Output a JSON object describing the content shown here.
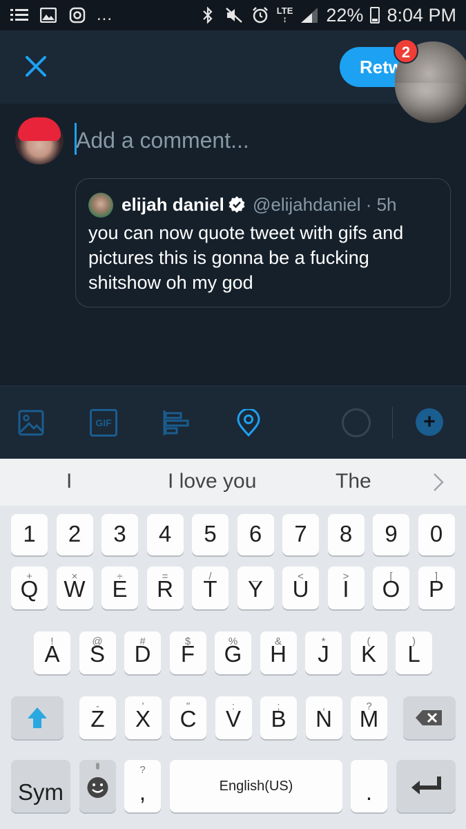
{
  "status_bar": {
    "network": "LTE",
    "battery": "22%",
    "battery_level": 0.22,
    "time": "8:04 PM",
    "overflow": "...",
    "left_icons": [
      "list-icon",
      "gallery-icon",
      "instagram-icon"
    ],
    "right_icons": [
      "bluetooth-icon",
      "mute-icon",
      "alarm-icon",
      "signal-icon",
      "battery-icon"
    ]
  },
  "header": {
    "close_icon": "close-icon",
    "retweet_label": "Retw",
    "notification_count": "2"
  },
  "compose": {
    "placeholder": "Add a comment..."
  },
  "quoted_tweet": {
    "name": "elijah daniel",
    "handle": "@elijahdaniel · 5h",
    "text": "you can now quote tweet with gifs and pictures this is gonna be a fucking shitshow oh my god"
  },
  "toolbar": {
    "icons": [
      "image-icon",
      "gif-icon",
      "poll-icon",
      "location-icon",
      "character-counter-icon",
      "add-tweet-icon"
    ],
    "gif_label": "GIF",
    "add_label": "+",
    "accent": "#1da1f2"
  },
  "keyboard": {
    "suggestions": [
      "I",
      "I love you",
      "The"
    ],
    "row_numbers": [
      "1",
      "2",
      "3",
      "4",
      "5",
      "6",
      "7",
      "8",
      "9",
      "0"
    ],
    "row_q": [
      {
        "k": "Q",
        "s": "+"
      },
      {
        "k": "W",
        "s": "×"
      },
      {
        "k": "E",
        "s": "÷"
      },
      {
        "k": "R",
        "s": "="
      },
      {
        "k": "T",
        "s": "/"
      },
      {
        "k": "Y",
        "s": "_"
      },
      {
        "k": "U",
        "s": "<"
      },
      {
        "k": "I",
        "s": ">"
      },
      {
        "k": "O",
        "s": "["
      },
      {
        "k": "P",
        "s": "]"
      }
    ],
    "row_a": [
      {
        "k": "A",
        "s": "!"
      },
      {
        "k": "S",
        "s": "@"
      },
      {
        "k": "D",
        "s": "#"
      },
      {
        "k": "F",
        "s": "$"
      },
      {
        "k": "G",
        "s": "%"
      },
      {
        "k": "H",
        "s": "&"
      },
      {
        "k": "J",
        "s": "*"
      },
      {
        "k": "K",
        "s": "("
      },
      {
        "k": "L",
        "s": ")"
      }
    ],
    "row_z": [
      {
        "k": "Z",
        "s": "-"
      },
      {
        "k": "X",
        "s": "'"
      },
      {
        "k": "C",
        "s": "\""
      },
      {
        "k": "V",
        "s": ":"
      },
      {
        "k": "B",
        "s": ";"
      },
      {
        "k": "N",
        "s": ","
      },
      {
        "k": "M",
        "s": "?"
      }
    ],
    "sym_label": "Sym",
    "comma_label": ",",
    "comma_sub": "?",
    "space_label": "English(US)",
    "period_label": "."
  }
}
